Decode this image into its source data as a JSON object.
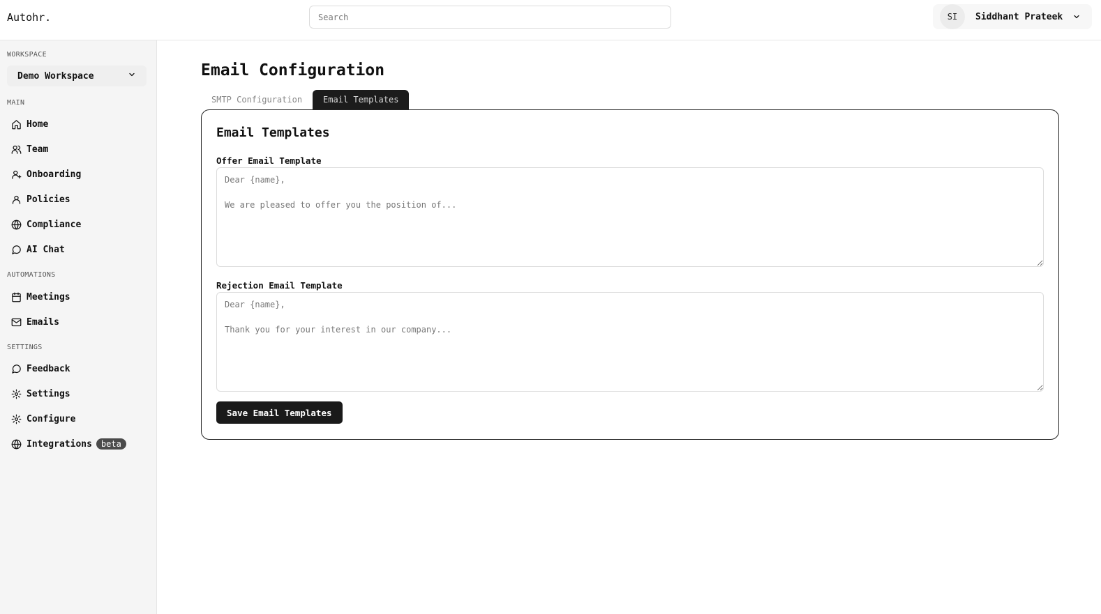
{
  "app": {
    "brand": "Autohr."
  },
  "search": {
    "placeholder": "Search"
  },
  "user": {
    "initials": "SI",
    "name": "Siddhant Prateek"
  },
  "sidebar": {
    "workspace_label": "WORKSPACE",
    "workspace_value": "Demo Workspace",
    "sections": {
      "main": "MAIN",
      "automations": "AUTOMATIONS",
      "settings": "SETTINGS"
    },
    "main_items": [
      {
        "label": "Home",
        "icon": "home-icon"
      },
      {
        "label": "Team",
        "icon": "users-icon"
      },
      {
        "label": "Onboarding",
        "icon": "user-plus-icon"
      },
      {
        "label": "Policies",
        "icon": "user-icon"
      },
      {
        "label": "Compliance",
        "icon": "globe-icon"
      },
      {
        "label": "AI Chat",
        "icon": "chat-icon"
      }
    ],
    "automation_items": [
      {
        "label": "Meetings",
        "icon": "calendar-icon"
      },
      {
        "label": "Emails",
        "icon": "mail-icon"
      }
    ],
    "settings_items": [
      {
        "label": "Feedback",
        "icon": "chat-icon"
      },
      {
        "label": "Settings",
        "icon": "gear-icon"
      },
      {
        "label": "Configure",
        "icon": "gear-icon"
      },
      {
        "label": "Integrations",
        "icon": "globe-icon",
        "badge": "beta"
      }
    ]
  },
  "page": {
    "title": "Email Configuration",
    "tabs": [
      {
        "label": "SMTP Configuration",
        "active": false
      },
      {
        "label": "Email Templates",
        "active": true
      }
    ],
    "card_title": "Email Templates",
    "offer": {
      "label": "Offer Email Template",
      "placeholder": "Dear {name},\n\nWe are pleased to offer you the position of..."
    },
    "rejection": {
      "label": "Rejection Email Template",
      "placeholder": "Dear {name},\n\nThank you for your interest in our company..."
    },
    "save_label": "Save Email Templates"
  }
}
